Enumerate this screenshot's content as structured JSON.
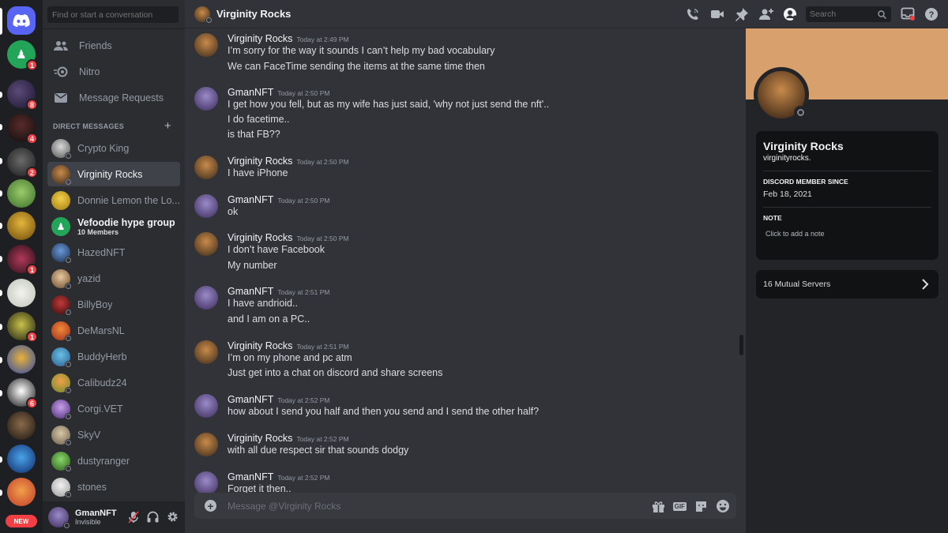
{
  "colors": {
    "brand": "#5865f2",
    "danger": "#f23f43",
    "online": "#23a559",
    "banner": "#d8a06c"
  },
  "rail": {
    "servers": [
      {
        "name": "home",
        "badge": ""
      },
      {
        "name": "friends-server",
        "badge": "1"
      },
      {
        "name": "hos-server",
        "badge": "8"
      },
      {
        "name": "adahi-server",
        "badge": "4"
      },
      {
        "name": "sins-server",
        "badge": "2"
      },
      {
        "name": "pepe-server",
        "badge": ""
      },
      {
        "name": "anubis-server",
        "badge": ""
      },
      {
        "name": "ring-server",
        "badge": "1"
      },
      {
        "name": "frogs-server",
        "badge": ""
      },
      {
        "name": "lion-server",
        "badge": "1"
      },
      {
        "name": "spliggies-server",
        "badge": ""
      },
      {
        "name": "ghost-server",
        "badge": "6"
      },
      {
        "name": "dragon-server",
        "badge": ""
      },
      {
        "name": "hazed-server",
        "badge": ""
      },
      {
        "name": "stoner-server",
        "badge": ""
      }
    ],
    "new_label": "NEW"
  },
  "dms": {
    "search_placeholder": "Find or start a conversation",
    "nav": [
      {
        "label": "Friends",
        "icon": "friends-icon"
      },
      {
        "label": "Nitro",
        "icon": "nitro-icon"
      },
      {
        "label": "Message Requests",
        "icon": "envelope-icon"
      }
    ],
    "header": "DIRECT MESSAGES",
    "items": [
      {
        "name": "Crypto King",
        "sub": ""
      },
      {
        "name": "Virginity Rocks",
        "sub": ""
      },
      {
        "name": "Donnie Lemon the Lo...",
        "sub": ""
      },
      {
        "name": "Vefoodie hype group",
        "sub": "10 Members"
      },
      {
        "name": "HazedNFT",
        "sub": ""
      },
      {
        "name": "yazid",
        "sub": ""
      },
      {
        "name": "BillyBoy",
        "sub": ""
      },
      {
        "name": "DeMarsNL",
        "sub": ""
      },
      {
        "name": "BuddyHerb",
        "sub": ""
      },
      {
        "name": "Calibudz24",
        "sub": ""
      },
      {
        "name": "Corgi.VET",
        "sub": ""
      },
      {
        "name": "SkyV",
        "sub": ""
      },
      {
        "name": "dustyranger",
        "sub": ""
      },
      {
        "name": "stones",
        "sub": ""
      }
    ]
  },
  "user": {
    "name": "GmanNFT",
    "status": "Invisible"
  },
  "topbar": {
    "title": "Virginity Rocks",
    "search_placeholder": "Search"
  },
  "messages": [
    {
      "author": "Virginity Rocks",
      "time": "Today at 2:49 PM",
      "lines": [
        "I’m sorry for the way it sounds I can’t help my bad vocabulary",
        "We can FaceTime sending the items at the same time then"
      ]
    },
    {
      "author": "GmanNFT",
      "time": "Today at 2:50 PM",
      "lines": [
        "I get how you fell,  but as my wife has just said, 'why not just send the nft'..",
        "I do facetime..",
        "is that FB??"
      ]
    },
    {
      "author": "Virginity Rocks",
      "time": "Today at 2:50 PM",
      "lines": [
        "I have iPhone"
      ]
    },
    {
      "author": "GmanNFT",
      "time": "Today at 2:50 PM",
      "lines": [
        "ok"
      ]
    },
    {
      "author": "Virginity Rocks",
      "time": "Today at 2:50 PM",
      "lines": [
        "I don’t have Facebook",
        "My number"
      ]
    },
    {
      "author": "GmanNFT",
      "time": "Today at 2:51 PM",
      "lines": [
        "I have andrioid..",
        "and I am on a PC.."
      ]
    },
    {
      "author": "Virginity Rocks",
      "time": "Today at 2:51 PM",
      "lines": [
        "I’m on my phone and pc atm",
        "Just get into a chat on discord and share screens"
      ]
    },
    {
      "author": "GmanNFT",
      "time": "Today at 2:52 PM",
      "lines": [
        "how about I send you half and then you send and I send the other half?"
      ]
    },
    {
      "author": "Virginity Rocks",
      "time": "Today at 2:52 PM",
      "lines": [
        "with all due respect sir that sounds dodgy"
      ]
    },
    {
      "author": "GmanNFT",
      "time": "Today at 2:52 PM",
      "lines": [
        "Forget it then.."
      ]
    }
  ],
  "composer": {
    "placeholder": "Message @Virginity Rocks",
    "gif_label": "GIF"
  },
  "profile": {
    "name": "Virginity Rocks",
    "username": "virginityrocks.",
    "member_since_label": "DISCORD MEMBER SINCE",
    "member_since": "Feb 18, 2021",
    "note_label": "NOTE",
    "note_placeholder": "Click to add a note",
    "mutual_servers": "16 Mutual Servers"
  }
}
